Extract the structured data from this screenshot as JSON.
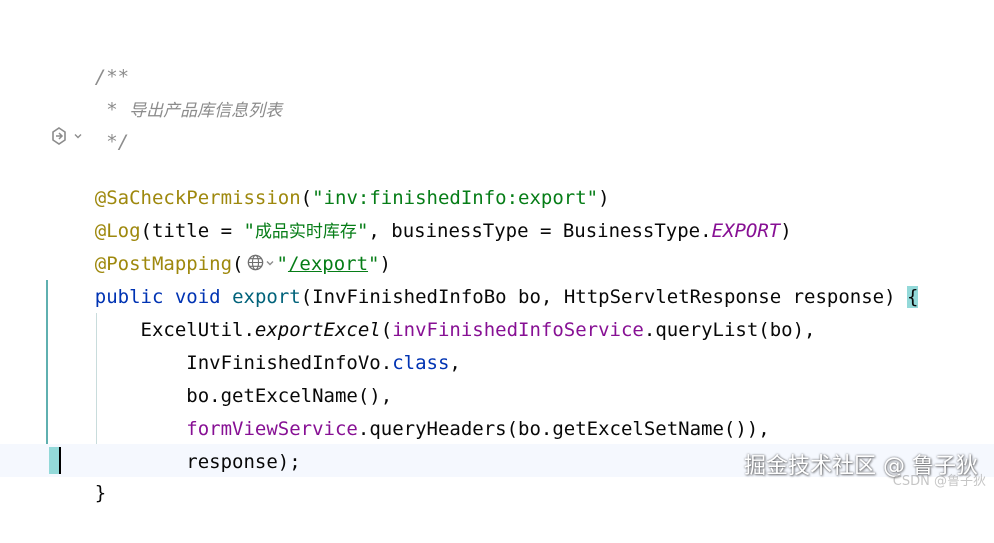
{
  "code": {
    "comment_open": "/**",
    "comment_star": " * ",
    "comment_text": "导出产品库信息列表",
    "comment_close": " */",
    "ann1_name": "@SaCheckPermission",
    "ann1_open": "(",
    "ann1_value": "\"inv:finishedInfo:export\"",
    "ann1_close": ")",
    "ann2_name": "@Log",
    "ann2_open": "(title = ",
    "ann2_q1": "\"",
    "ann2_value": "成品实时库存",
    "ann2_q2": "\"",
    "ann2_mid": ", businessType = BusinessType.",
    "ann2_enum": "EXPORT",
    "ann2_close": ")",
    "ann3_name": "@PostMapping",
    "ann3_open": "(",
    "ann3_q1": "\"",
    "ann3_value": "/export",
    "ann3_q2": "\"",
    "ann3_close": ")",
    "sig_public": "public",
    "sig_void": "void",
    "sig_name": "export",
    "sig_params": "(InvFinishedInfoBo bo, HttpServletResponse response) ",
    "sig_brace": "{",
    "l1_indent": "    ",
    "l1_class": "ExcelUtil.",
    "l1_method": "exportExcel",
    "l1_open": "(",
    "l1_field": "invFinishedInfoService",
    "l1_rest": ".queryList(bo),",
    "l2_indent": "        ",
    "l2_class": "InvFinishedInfoVo.",
    "l2_kw": "class",
    "l2_comma": ",",
    "l3_text": "        bo.getExcelName(),",
    "l4_indent": "        ",
    "l4_field": "formViewService",
    "l4_rest": ".queryHeaders(bo.getExcelSetName()),",
    "l5_text": "        response);",
    "close_brace": "}"
  },
  "gutter": {
    "icon": "endpoint-icon",
    "chevron": "chevron-down-icon"
  },
  "inlay": {
    "icon": "globe-icon",
    "chevron": "chevron-down-icon"
  },
  "watermark": {
    "main": "掘金技术社区 @ 鲁子狄",
    "small": "CSDN @鲁子狄"
  },
  "colors": {
    "comment": "#8c8c8c",
    "annotation": "#9e880d",
    "string": "#067d17",
    "keyword": "#0033b3",
    "method": "#00627a",
    "field": "#871094",
    "brace_highlight": "#93d9d9"
  }
}
